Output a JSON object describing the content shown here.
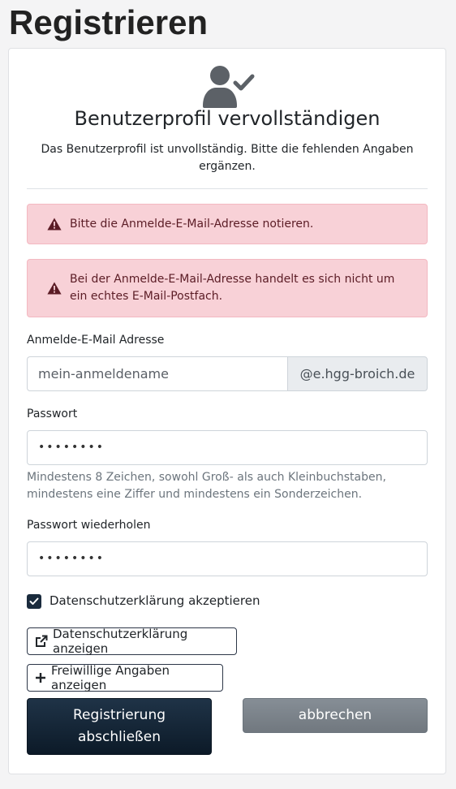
{
  "page": {
    "title": "Registrieren"
  },
  "card": {
    "heading": "Benutzerprofil vervollständigen",
    "subtitle": "Das Benutzerprofil ist unvollständig. Bitte die fehlenden Angaben ergänzen."
  },
  "alerts": [
    {
      "text": "Bitte die Anmelde-E-Mail-Adresse notieren."
    },
    {
      "text": "Bei der Anmelde-E-Mail-Adresse handelt es sich nicht um ein echtes E-Mail-Postfach."
    }
  ],
  "form": {
    "login_email": {
      "label": "Anmelde-E-Mail Adresse",
      "value": "mein-anmeldename",
      "addon": "@e.hgg-broich.de"
    },
    "password": {
      "label": "Passwort",
      "value": "••••••••",
      "hint": "Mindestens 8 Zeichen, sowohl Groß- als auch Kleinbuchstaben, mindestens eine Ziffer und mindestens ein Sonderzeichen."
    },
    "password_repeat": {
      "label": "Passwort wiederholen",
      "value": "••••••••"
    },
    "privacy_checkbox": {
      "label": "Datenschutzerklärung akzeptieren",
      "checked": true
    }
  },
  "buttons": {
    "show_privacy": "Datenschutzerklärung anzeigen",
    "show_optional": "Freiwillige Angaben anzeigen",
    "submit": "Registrierung abschließen",
    "cancel": "abbrechen"
  },
  "icons": {
    "header": "user-check-icon",
    "alert": "warning-triangle-icon",
    "external": "external-link-icon",
    "plus": "plus-icon",
    "check": "checkmark-icon"
  },
  "colors": {
    "primary": "#0c1a28",
    "secondary": "#6c757d",
    "alert_bg": "#f8d1d7",
    "alert_text": "#5b1c25"
  }
}
